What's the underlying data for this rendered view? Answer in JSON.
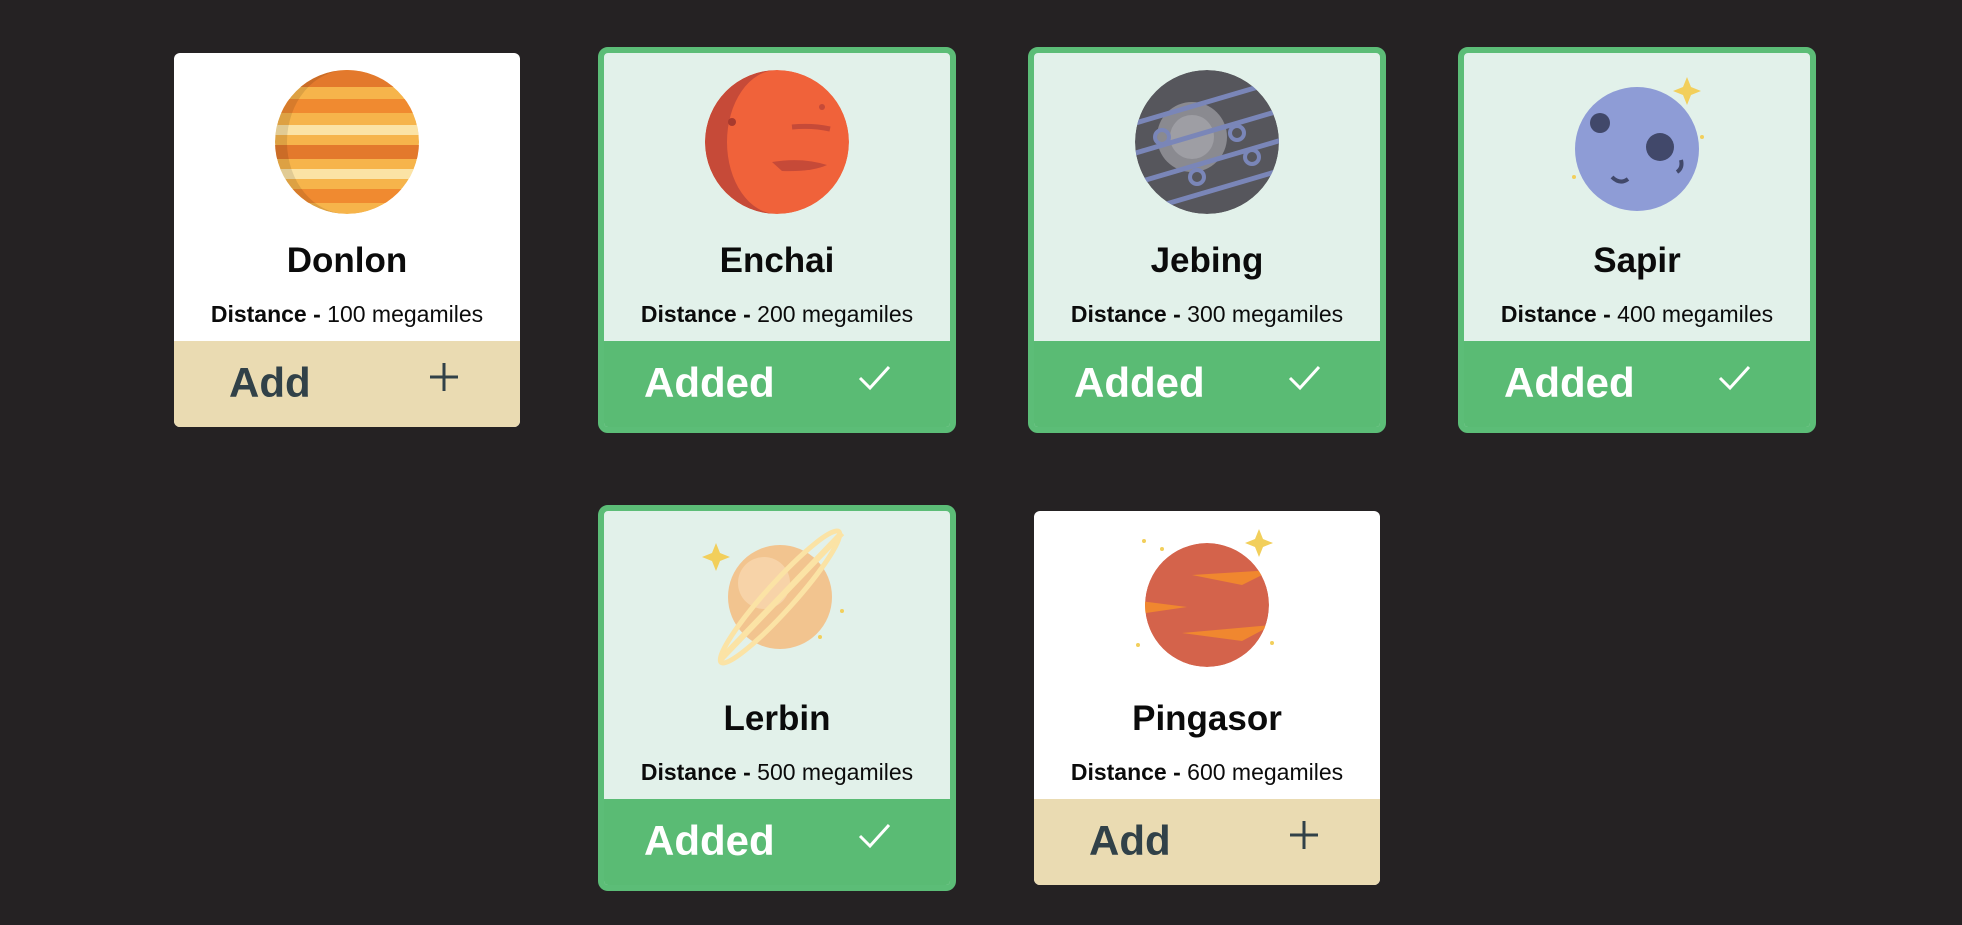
{
  "distance_label": "Distance -",
  "planets": [
    {
      "name": "Donlon",
      "distance": "100 megamiles",
      "action": "Add",
      "icon": "plus-icon",
      "color": "#f29a36"
    },
    {
      "name": "Enchai",
      "distance": "200 megamiles",
      "action": "Added",
      "icon": "check-icon",
      "color": "#e45b3e"
    },
    {
      "name": "Jebing",
      "distance": "300 megamiles",
      "action": "Added",
      "icon": "check-icon",
      "color": "#5d5d62"
    },
    {
      "name": "Sapir",
      "distance": "400 megamiles",
      "action": "Added",
      "icon": "check-icon",
      "color": "#8e9cd6"
    },
    {
      "name": "Lerbin",
      "distance": "500 megamiles",
      "action": "Added",
      "icon": "check-icon",
      "color": "#f2c48f"
    },
    {
      "name": "Pingasor",
      "distance": "600 megamiles",
      "action": "Add",
      "icon": "plus-icon",
      "color": "#d4634b"
    }
  ]
}
